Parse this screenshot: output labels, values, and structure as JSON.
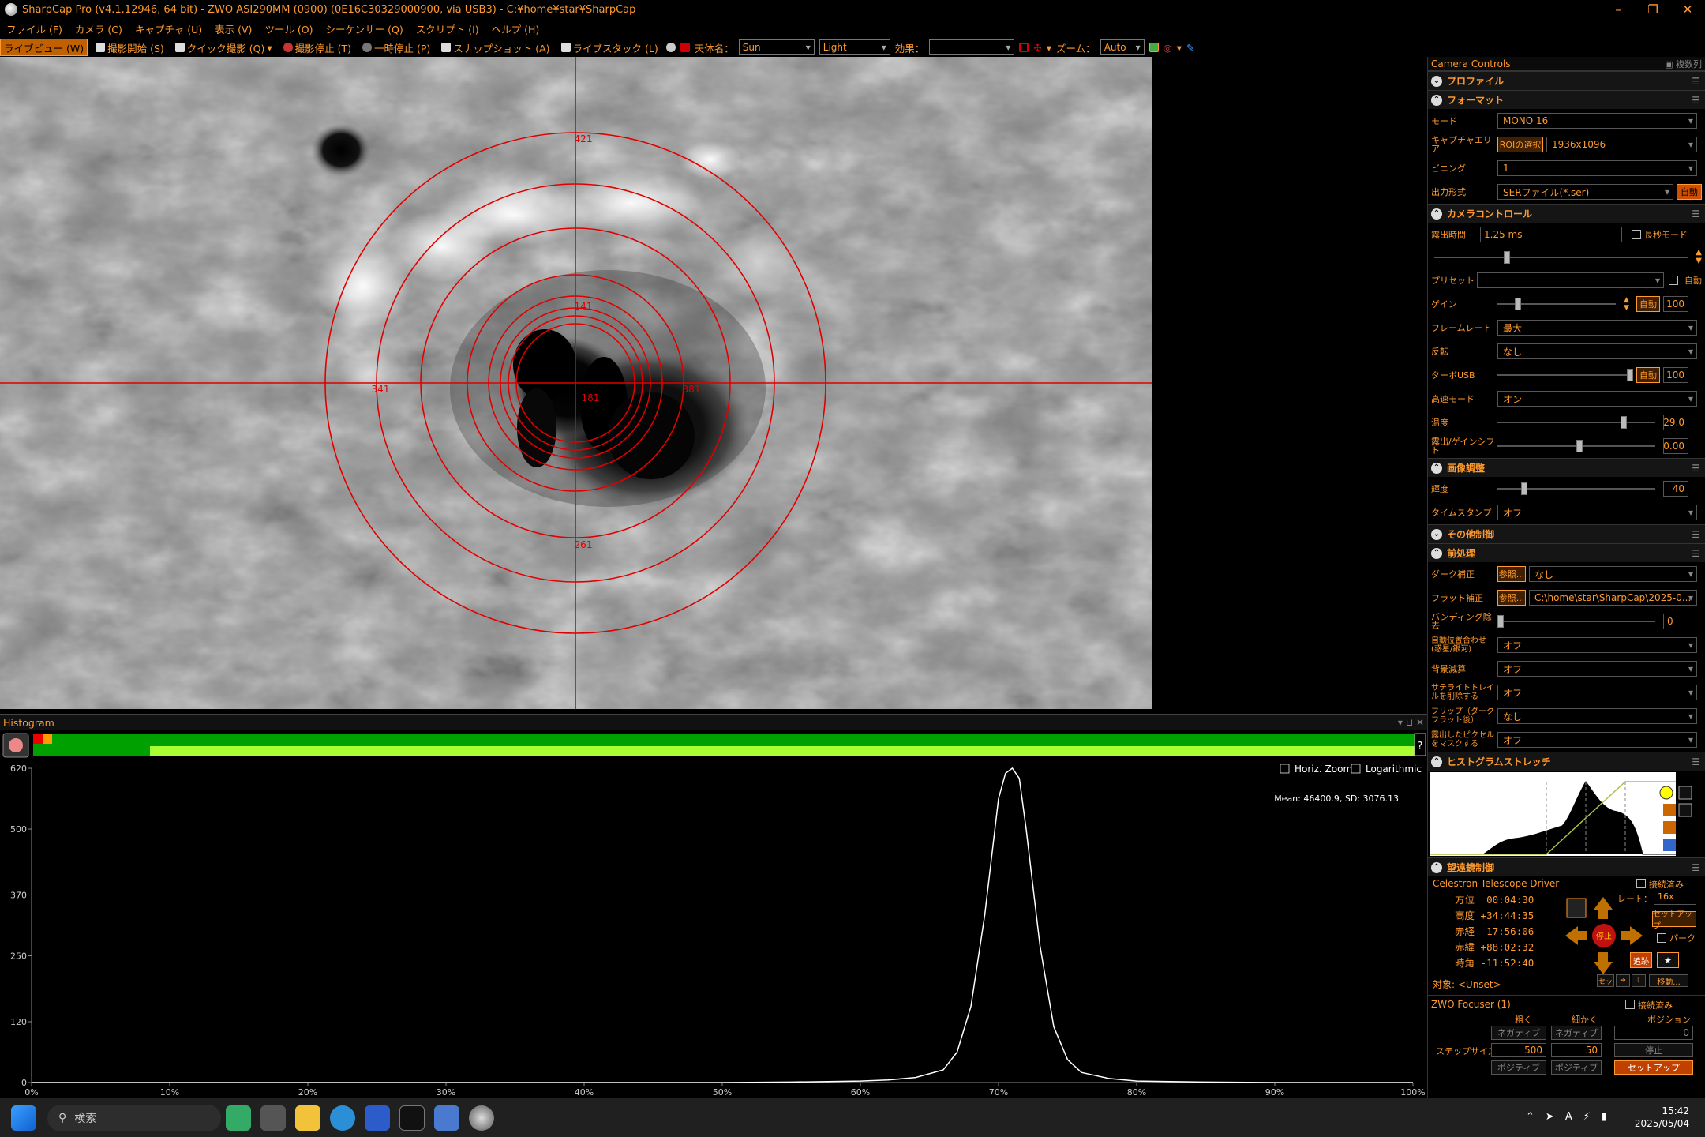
{
  "title": "SharpCap Pro (v4.1.12946, 64 bit) - ZWO ASI290MM (0900) (0E16C30329000900, via USB3) - C:¥home¥star¥SharpCap",
  "menu": [
    "ファイル (F)",
    "カメラ (C)",
    "キャプチャ (U)",
    "表示 (V)",
    "ツール (O)",
    "シーケンサー (Q)",
    "スクリプト (I)",
    "ヘルプ (H)"
  ],
  "toolbar": {
    "live_view": "ライブビュー (W)",
    "start_capture": "撮影開始 (S)",
    "quick_capture": "クイック撮影 (Q)",
    "stop_capture": "撮影停止 (T)",
    "pause": "一時停止 (P)",
    "snapshot": "スナップショット (A)",
    "live_stack": "ライブスタック (L)",
    "target_label": "天体名：",
    "target_value": "Sun",
    "light_value": "Light",
    "effect_label": "効果：",
    "effect_value": "",
    "zoom_label": "ズーム：",
    "zoom_value": "Auto"
  },
  "reticle": {
    "labels": [
      "421",
      "341",
      "381",
      "141",
      "261",
      "181"
    ],
    "color": "#e00000"
  },
  "histogram": {
    "title": "Histogram",
    "horiz_zoom": "Horiz. Zoom",
    "logarithmic": "Logarithmic",
    "stats": "Mean: 46400.9, SD: 3076.13",
    "help": "?",
    "y_ticks": [
      "620",
      "500",
      "370",
      "250",
      "120",
      "0"
    ],
    "x_ticks": [
      "0%",
      "10%",
      "20%",
      "30%",
      "40%",
      "50%",
      "60%",
      "70%",
      "80%",
      "90%",
      "100%"
    ]
  },
  "chart_data": {
    "type": "area",
    "title": "Histogram",
    "x": [
      0,
      10,
      20,
      30,
      40,
      50,
      55,
      60,
      62,
      64,
      66,
      67,
      68,
      69,
      70,
      70.5,
      71,
      71.5,
      72,
      73,
      74,
      75,
      76,
      78,
      80,
      85,
      90,
      95,
      100
    ],
    "values": [
      0,
      0,
      0,
      0,
      0,
      0,
      1,
      3,
      5,
      10,
      25,
      60,
      150,
      330,
      560,
      610,
      620,
      600,
      500,
      270,
      110,
      45,
      20,
      8,
      3,
      1,
      0,
      0,
      0
    ],
    "xlabel": "",
    "ylabel": "",
    "xlim": [
      0,
      100
    ],
    "ylim": [
      0,
      620
    ],
    "stats": "Mean: 46400.9, SD: 3076.13"
  },
  "panel": {
    "title": "Camera Controls",
    "float_label": "複数列",
    "profile": "プロファイル",
    "format": "フォーマット",
    "mode_label": "モード",
    "mode_value": "MONO 16",
    "capture_area_label": "キャプチャエリア",
    "roi_button": "ROIの選択",
    "capture_area_value": "1936x1096",
    "binning_label": "ビニング",
    "binning_value": "1",
    "output_label": "出力形式",
    "output_value": "SERファイル(*.ser)",
    "output_auto": "自動",
    "camera_control": "カメラコントロール",
    "exposure_label": "露出時間",
    "exposure_value": "1.25 ms",
    "long_exposure": "長秒モード",
    "preset_label": "プリセット",
    "preset_auto": "自動",
    "gain_label": "ゲイン",
    "gain_auto": "自動",
    "gain_value": "100",
    "framerate_label": "フレームレート",
    "framerate_value": "最大",
    "flip_label": "反転",
    "flip_value": "なし",
    "turbo_label": "ターボUSB",
    "turbo_auto": "自動",
    "turbo_value": "100",
    "speed_label": "高速モード",
    "speed_value": "オン",
    "temp_label": "温度",
    "temp_value": "29.0",
    "expgain_label": "露出/ゲインシフト",
    "expgain_value": "0.00",
    "image_adjust": "画像調整",
    "brightness_label": "輝度",
    "brightness_value": "40",
    "timestamp_label": "タイムスタンプ",
    "timestamp_value": "オフ",
    "misc": "その他制御",
    "preprocess": "前処理",
    "dark_label": "ダーク補正",
    "dark_button": "参照...",
    "dark_value": "なし",
    "flat_label": "フラット補正",
    "flat_button": "参照...",
    "flat_value": "C:\\home\\star\\SharpCap\\2025-0...",
    "banding_label": "バンディング除去",
    "banding_value": "0",
    "align_label": "自動位置合わせ (惑星/銀河)",
    "align_value": "オフ",
    "bgsub_label": "背景減算",
    "bgsub_value": "オフ",
    "satellite_label": "サテライトトレイルを削除する",
    "satellite_value": "オフ",
    "flipdark_label": "フリップ（ダークフラット後）",
    "flipdark_value": "なし",
    "mask_label": "露出したピクセルをマスクする",
    "mask_value": "オフ",
    "stretch": "ヒストグラムストレッチ",
    "telescope": "望遠鏡制御",
    "driver": "Celestron Telescope Driver",
    "connected": "接続済み",
    "az_label": "方位",
    "az_value": "00:04:30",
    "alt_label": "高度",
    "alt_value": "+34:44:35",
    "ra_label": "赤経",
    "ra_value": "17:56:06",
    "dec_label": "赤緯",
    "dec_value": "+88:02:32",
    "ha_label": "時角",
    "ha_value": "-11:52:40",
    "rate_label": "レート：",
    "rate_value": "16x",
    "stop_label": "停止",
    "setup_label": "セットアップ",
    "park_label": "パーク",
    "track_label": "追跡",
    "target_label": "対象: <Unset>",
    "set_label": "セッ",
    "move_label": "移動...",
    "focuser": "ZWO Focuser (1)",
    "focuser_connected": "接続済み",
    "coarse": "粗く",
    "fine": "細かく",
    "position": "ポジション",
    "negative": "ネガティブ",
    "positive": "ポジティブ",
    "position_value": "0",
    "step_label": "ステップサイズ",
    "step_coarse": "500",
    "step_fine": "50",
    "f_stop": "停止",
    "f_setup": "セットアップ"
  },
  "taskbar": {
    "search": "検索",
    "time": "15:42",
    "date": "2025/05/04"
  }
}
